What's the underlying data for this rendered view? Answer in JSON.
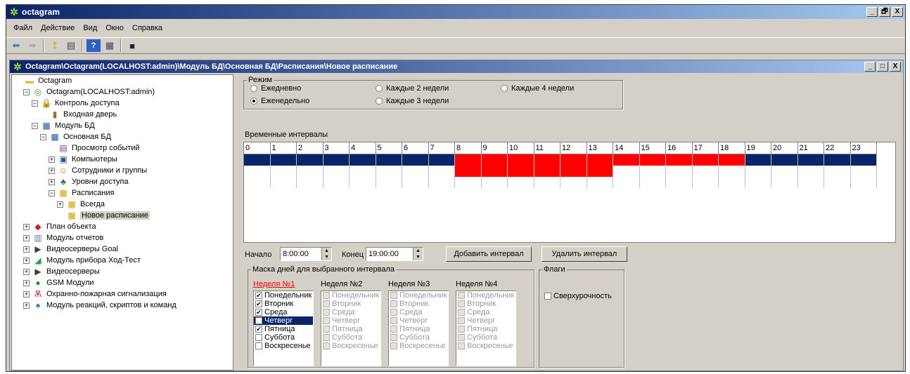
{
  "app": {
    "title": "octagram",
    "window_buttons": [
      "_",
      "🗗",
      "X"
    ]
  },
  "menu": [
    "Файл",
    "Действие",
    "Вид",
    "Окно",
    "Справка"
  ],
  "child": {
    "title": "Octagram\\Octagram(LOCALHOST:admin)\\Модуль БД\\Основная БД\\Расписания\\Новое расписание",
    "window_buttons": [
      "_",
      "□",
      "X"
    ]
  },
  "tree": [
    {
      "label": "Octagram",
      "indent": 0,
      "pm": "",
      "icon": "folder-icon"
    },
    {
      "label": "Octagram(LOCALHOST:admin)",
      "indent": 1,
      "pm": "−",
      "icon": "server-icon"
    },
    {
      "label": "Контроль доступа",
      "indent": 2,
      "pm": "−",
      "icon": "lock-icon"
    },
    {
      "label": "Входная дверь",
      "indent": 3,
      "pm": "",
      "icon": "door-icon"
    },
    {
      "label": "Модуль БД",
      "indent": 2,
      "pm": "−",
      "icon": "database-icon"
    },
    {
      "label": "Основная БД",
      "indent": 3,
      "pm": "−",
      "icon": "database-icon"
    },
    {
      "label": "Просмотр событий",
      "indent": 4,
      "pm": "",
      "icon": "events-icon"
    },
    {
      "label": "Компьютеры",
      "indent": 4,
      "pm": "+",
      "icon": "computer-icon"
    },
    {
      "label": "Сотрудники и группы",
      "indent": 4,
      "pm": "+",
      "icon": "users-icon"
    },
    {
      "label": "Уровни доступа",
      "indent": 4,
      "pm": "+",
      "icon": "levels-icon"
    },
    {
      "label": "Расписания",
      "indent": 4,
      "pm": "−",
      "icon": "calendar-icon"
    },
    {
      "label": "Всегда",
      "indent": 5,
      "pm": "+",
      "icon": "calendar-icon"
    },
    {
      "label": "Новое расписание",
      "indent": 5,
      "pm": "",
      "icon": "calendar-icon",
      "selected": true
    },
    {
      "label": "План объекта",
      "indent": 1,
      "pm": "+",
      "icon": "plan-icon"
    },
    {
      "label": "Модуль отчетов",
      "indent": 1,
      "pm": "+",
      "icon": "report-icon"
    },
    {
      "label": "Видеосерверы Goal",
      "indent": 1,
      "pm": "+",
      "icon": "video-icon"
    },
    {
      "label": "Модуль прибора Ход-Тест",
      "indent": 1,
      "pm": "+",
      "icon": "device-icon"
    },
    {
      "label": "Видеосерверы",
      "indent": 1,
      "pm": "+",
      "icon": "video-icon"
    },
    {
      "label": "GSM Модули",
      "indent": 1,
      "pm": "+",
      "icon": "gsm-icon"
    },
    {
      "label": "Охранно-пожарная сигнализация",
      "indent": 1,
      "pm": "+",
      "icon": "alarm-icon"
    },
    {
      "label": "Модуль реакций, скриптов и команд",
      "indent": 1,
      "pm": "+",
      "icon": "script-icon"
    }
  ],
  "mode": {
    "legend": "Режим",
    "options": [
      "Ежедневно",
      "Еженедельно",
      "Каждые 2 недели",
      "Каждые 3 недели",
      "Каждые 4 недели"
    ],
    "selected": "Еженедельно"
  },
  "intervals": {
    "label": "Временные интервалы",
    "hours": [
      "0",
      "1",
      "2",
      "3",
      "4",
      "5",
      "6",
      "7",
      "8",
      "9",
      "10",
      "11",
      "12",
      "13",
      "14",
      "15",
      "16",
      "17",
      "18",
      "19",
      "20",
      "21",
      "22",
      "23"
    ],
    "rows": [
      {
        "selected": true,
        "red_from": 8,
        "red_to": 19
      },
      {
        "selected": false,
        "red_from": 8,
        "red_to": 14
      },
      {
        "selected": false,
        "red_from": null,
        "red_to": null
      }
    ],
    "colors": {
      "red": "#ff0000",
      "selected_row": "#0a246a"
    }
  },
  "start": {
    "label": "Начало",
    "value": "8:00:00"
  },
  "end": {
    "label": "Конец",
    "value": "19:00:00"
  },
  "add_button": "Добавить интервал",
  "delete_button": "Удалить интервал",
  "mask": {
    "legend": "Маска дней для выбранного интервала",
    "weeks": [
      "Неделя №1",
      "Неделя №2",
      "Неделя №3",
      "Неделя №4"
    ],
    "days": [
      "Понедельник",
      "Вторник",
      "Среда",
      "Четверг",
      "Пятница",
      "Суббота",
      "Воскресенье"
    ],
    "week1_checked": [
      true,
      true,
      true,
      true,
      true,
      false,
      false
    ],
    "week1_highlight": 3,
    "active_week_color": "#ff0000"
  },
  "flags": {
    "legend": "Флаги",
    "overtime": "Сверхурочность",
    "overtime_checked": false
  }
}
